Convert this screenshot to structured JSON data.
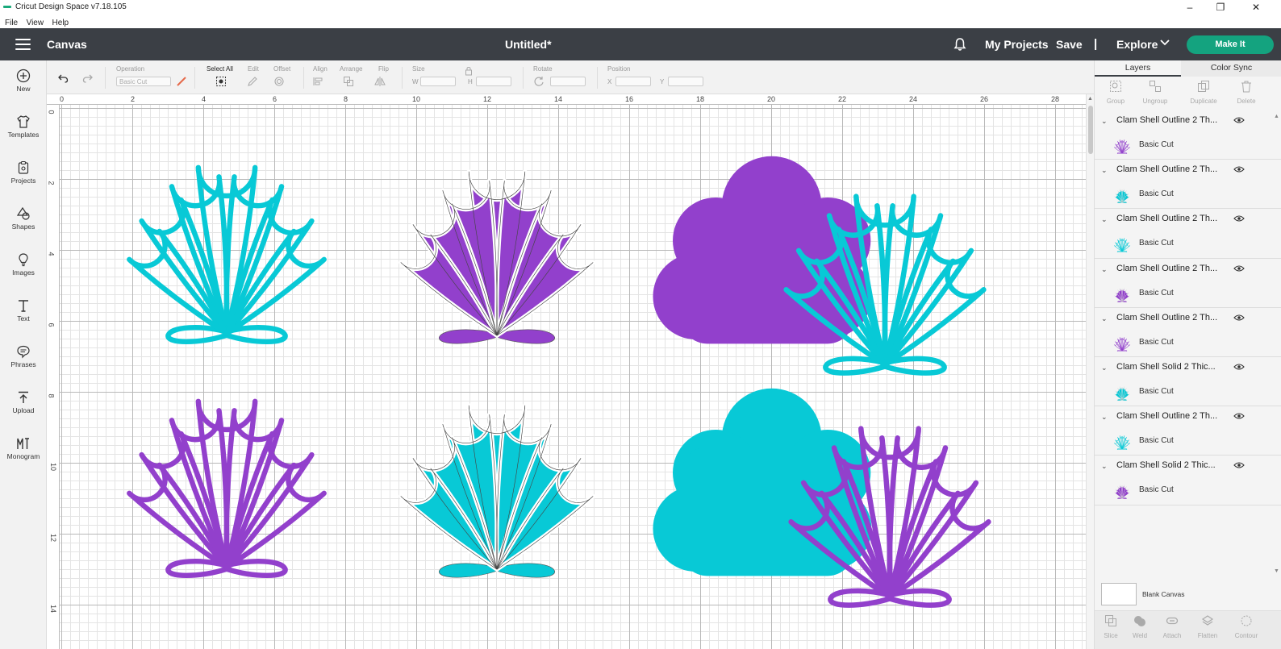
{
  "window": {
    "title": "Cricut Design Space  v7.18.105",
    "minimize": "–",
    "maximize": "❐",
    "close": "✕"
  },
  "menu": [
    "File",
    "View",
    "Help"
  ],
  "header": {
    "canvas_label": "Canvas",
    "document_title": "Untitled*",
    "my_projects": "My Projects",
    "save": "Save",
    "separator": "|",
    "explore": "Explore",
    "make_it": "Make It"
  },
  "leftbar": [
    "New",
    "Templates",
    "Projects",
    "Shapes",
    "Images",
    "Text",
    "Phrases",
    "Upload",
    "Monogram"
  ],
  "toolbar": {
    "operation_label": "Operation",
    "operation_value": "Basic Cut",
    "select_all": "Select All",
    "edit": "Edit",
    "offset": "Offset",
    "align": "Align",
    "arrange": "Arrange",
    "flip": "Flip",
    "size": "Size",
    "w": "W",
    "h": "H",
    "rotate": "Rotate",
    "position": "Position",
    "x": "X",
    "y": "Y"
  },
  "ruler": {
    "top": [
      "0",
      "2",
      "4",
      "6",
      "8",
      "10",
      "12",
      "14",
      "16",
      "18",
      "20",
      "22",
      "24",
      "26",
      "28"
    ],
    "left": [
      "0",
      "2",
      "4",
      "6",
      "8",
      "10",
      "12",
      "14"
    ]
  },
  "colors": {
    "teal": "#08c9d6",
    "purple": "#9240cc",
    "header_bg": "#3b3f45",
    "make_it": "#14a37f"
  },
  "panel": {
    "tabs": [
      "Layers",
      "Color Sync"
    ],
    "tools": [
      "Group",
      "Ungroup",
      "Duplicate",
      "Delete"
    ],
    "layers": [
      {
        "name": "Clam Shell Outline 2 Th...",
        "sub": "Basic Cut",
        "color": "#9240cc",
        "style": "outline"
      },
      {
        "name": "Clam Shell Outline 2 Th...",
        "sub": "Basic Cut",
        "color": "#08c9d6",
        "style": "solid"
      },
      {
        "name": "Clam Shell Outline 2 Th...",
        "sub": "Basic Cut",
        "color": "#08c9d6",
        "style": "outline"
      },
      {
        "name": "Clam Shell Outline 2 Th...",
        "sub": "Basic Cut",
        "color": "#9240cc",
        "style": "solid"
      },
      {
        "name": "Clam Shell Outline 2 Th...",
        "sub": "Basic Cut",
        "color": "#9240cc",
        "style": "outline"
      },
      {
        "name": "Clam Shell Solid 2 Thic...",
        "sub": "Basic Cut",
        "color": "#08c9d6",
        "style": "solid"
      },
      {
        "name": "Clam Shell Outline 2 Th...",
        "sub": "Basic Cut",
        "color": "#08c9d6",
        "style": "outline"
      },
      {
        "name": "Clam Shell Solid 2 Thic...",
        "sub": "Basic Cut",
        "color": "#9240cc",
        "style": "solid"
      }
    ],
    "blank_canvas": "Blank Canvas",
    "bottom_tools": [
      "Slice",
      "Weld",
      "Attach",
      "Flatten",
      "Contour"
    ]
  }
}
